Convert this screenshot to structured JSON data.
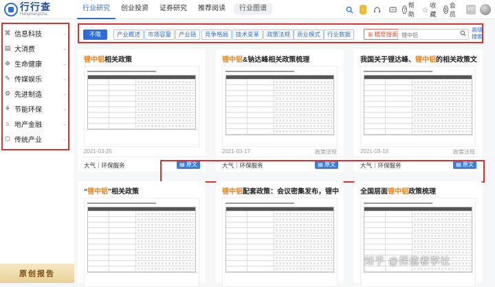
{
  "brand": {
    "name": "行行查",
    "pinyin": "HangHangCha"
  },
  "nav": {
    "items": [
      {
        "label": "行业研究",
        "active": true
      },
      {
        "label": "创业投资",
        "active": false
      },
      {
        "label": "证券研究",
        "active": false
      },
      {
        "label": "推荐阅读",
        "active": false
      }
    ],
    "pill": "行业图谱"
  },
  "top_icons": {
    "help": "帮助",
    "favorites": "收藏",
    "member": "会员"
  },
  "sidebar": {
    "items": [
      {
        "label": "信息科技",
        "icon": "⌘"
      },
      {
        "label": "大消费",
        "icon": "▤"
      },
      {
        "label": "生命健康",
        "icon": "⊕"
      },
      {
        "label": "传媒娱乐",
        "icon": "✎"
      },
      {
        "label": "先进制造",
        "icon": "⚙"
      },
      {
        "label": "节能环保",
        "icon": "⚘"
      },
      {
        "label": "地产金融",
        "icon": "⌂"
      },
      {
        "label": "传统产业",
        "icon": "⬡"
      }
    ],
    "promo": "原创报告"
  },
  "filters": {
    "chips": [
      "不限",
      "产业概述",
      "市场容量",
      "产业链",
      "竞争格局",
      "技术变革",
      "政策法规",
      "商业模式",
      "行业数据"
    ],
    "precise": "精度搜索",
    "search_placeholder": "锂中铝",
    "advanced": "高级搜索"
  },
  "cards": [
    {
      "title_hl": "锂中铝",
      "title_rest": "相关政策",
      "date": "2021-03-25",
      "tag": "",
      "category": "大气｜环保服务",
      "button": "原文"
    },
    {
      "title_hl": "锂中铝",
      "title_rest": "&钠达峰相关政策梳理",
      "date": "2021-03-17",
      "tag": "政策法规",
      "category": "大气｜环保服务",
      "button": "原文"
    },
    {
      "title_pre": "我国关于锂达峰、",
      "title_hl": "锂中铝",
      "title_rest": "的相关政策文件",
      "date": "2021-03-19",
      "tag": "政策法规",
      "category": "大气｜环保服务",
      "button": "原文"
    },
    {
      "title_pre": "“",
      "title_hl": "锂中铝",
      "title_rest": "”相关政策"
    },
    {
      "title_hl": "锂中铝",
      "title_rest": "配套政策：会议密集发布，锂中铝政..."
    },
    {
      "title_pre": "全国层面",
      "title_hl": "锂中铝",
      "title_rest": "政策梳理"
    }
  ],
  "watermark": "知乎 @探值者学社"
}
